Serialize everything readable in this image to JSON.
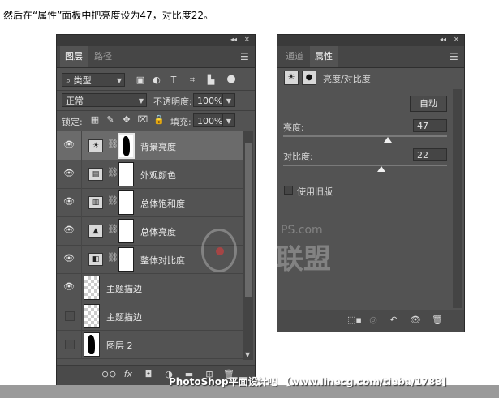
{
  "caption": "然后在“属性”面板中把亮度设为47，对比度22。",
  "window_controls": {
    "collapse": "◂◂",
    "close": "✕"
  },
  "layers_panel": {
    "tabs": [
      {
        "label": "图层",
        "active": true
      },
      {
        "label": "路径",
        "active": false
      }
    ],
    "filter_kind": "类型",
    "blend_mode": "正常",
    "opacity_label": "不透明度:",
    "opacity_value": "100%",
    "lock_label": "锁定:",
    "fill_label": "填充:",
    "fill_value": "100%",
    "layers": [
      {
        "name": "背景亮度",
        "visible": true,
        "type": "adjustment",
        "adj_icon": "☀",
        "selected": true,
        "mask": "silhouette"
      },
      {
        "name": "外观颜色",
        "visible": true,
        "type": "adjustment",
        "adj_icon": "▤",
        "selected": false,
        "mask": "white"
      },
      {
        "name": "总体饱和度",
        "visible": true,
        "type": "adjustment",
        "adj_icon": "▥",
        "selected": false,
        "mask": "white"
      },
      {
        "name": "总体亮度",
        "visible": true,
        "type": "adjustment",
        "adj_icon": "▲",
        "selected": false,
        "mask": "white"
      },
      {
        "name": "整体对比度",
        "visible": true,
        "type": "adjustment",
        "adj_icon": "◧",
        "selected": false,
        "mask": "white"
      },
      {
        "name": "主题描边",
        "visible": true,
        "type": "pixel",
        "selected": false
      },
      {
        "name": "主题描边",
        "visible": false,
        "type": "pixel",
        "selected": false
      },
      {
        "name": "图层 2",
        "visible": false,
        "type": "pixel-silhouette",
        "selected": false
      }
    ],
    "bottom_icons": [
      "⊖⊖",
      "fx",
      "◘",
      "◑",
      "▬",
      "⊞",
      "🗑"
    ]
  },
  "properties_panel": {
    "tabs": [
      {
        "label": "通道",
        "active": false
      },
      {
        "label": "属性",
        "active": true
      }
    ],
    "adjustment_name": "亮度/对比度",
    "auto_button": "自动",
    "brightness_label": "亮度:",
    "brightness_value": "47",
    "contrast_label": "对比度:",
    "contrast_value": "22",
    "legacy_label": "使用旧版",
    "legacy_checked": false,
    "brightness_level": 0.64,
    "contrast_level": 0.6
  },
  "watermark": {
    "site": "PS.com",
    "brand": "联盟"
  },
  "footer": "PhotoShop平面设计吧 【www.linecg.com/tieba/1783】"
}
